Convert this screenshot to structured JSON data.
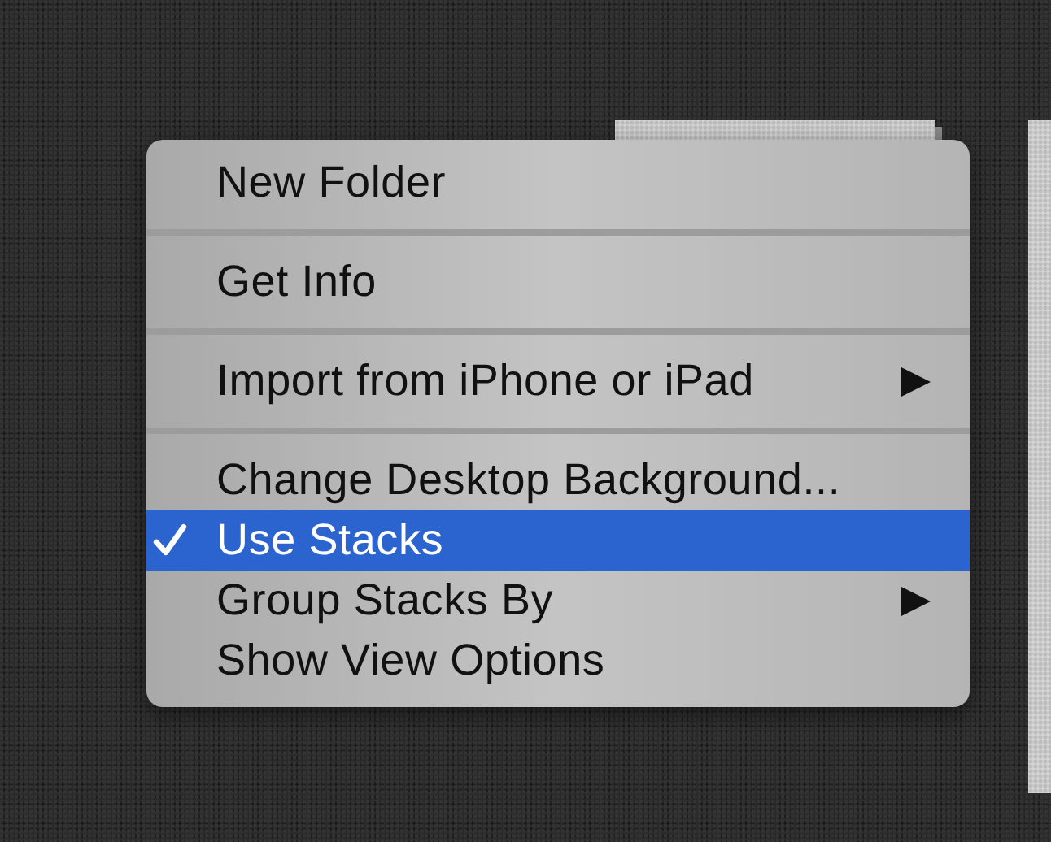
{
  "menu": {
    "items": [
      {
        "kind": "item",
        "label": "New Folder",
        "checked": false,
        "selected": false,
        "submenu": false
      },
      {
        "kind": "separator"
      },
      {
        "kind": "item",
        "label": "Get Info",
        "checked": false,
        "selected": false,
        "submenu": false
      },
      {
        "kind": "separator"
      },
      {
        "kind": "item",
        "label": "Import from iPhone or iPad",
        "checked": false,
        "selected": false,
        "submenu": true
      },
      {
        "kind": "separator"
      },
      {
        "kind": "item",
        "label": "Change Desktop Background...",
        "checked": false,
        "selected": false,
        "submenu": false
      },
      {
        "kind": "item",
        "label": "Use Stacks",
        "checked": true,
        "selected": true,
        "submenu": false
      },
      {
        "kind": "item",
        "label": "Group Stacks By",
        "checked": false,
        "selected": false,
        "submenu": true
      },
      {
        "kind": "item",
        "label": "Show View Options",
        "checked": false,
        "selected": false,
        "submenu": false
      }
    ]
  }
}
